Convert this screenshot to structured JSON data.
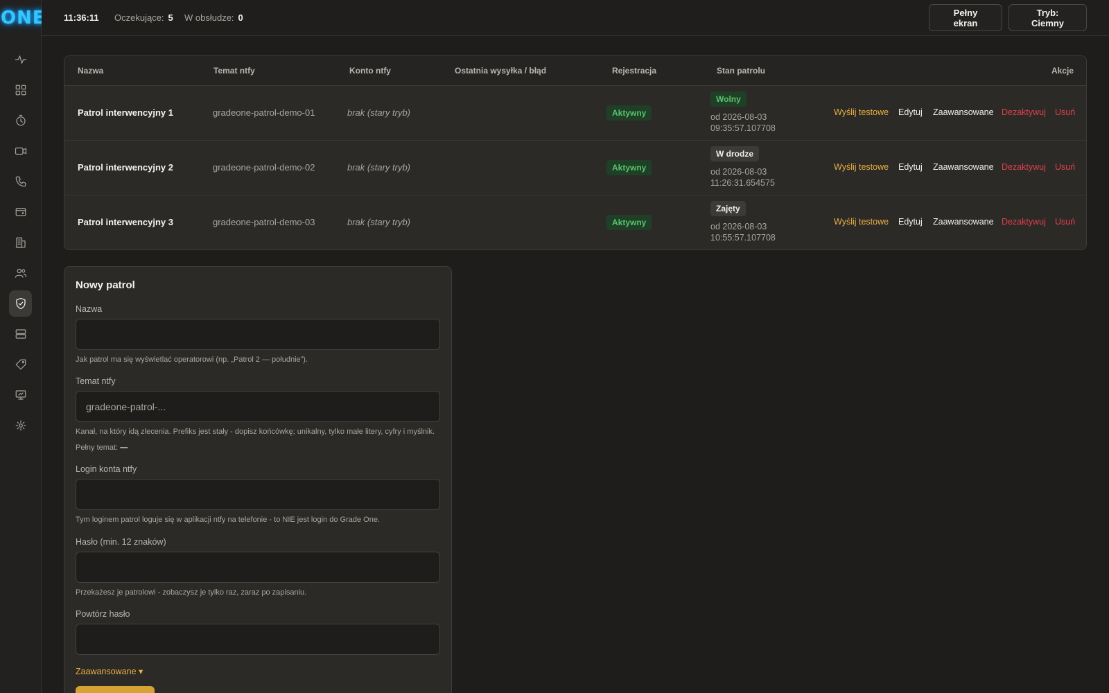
{
  "app": {
    "logo": "ONE"
  },
  "topbar": {
    "clock": "11:36:11",
    "pending_label": "Oczekujące:",
    "pending_value": "5",
    "in_service_label": "W obsłudze:",
    "in_service_value": "0",
    "fullscreen_label": "Pełny ekran",
    "mode_label": "Tryb: Ciemny"
  },
  "sidebar": {
    "items": [
      {
        "icon": "activity-icon"
      },
      {
        "icon": "dashboard-grid-icon"
      },
      {
        "icon": "timer-icon"
      },
      {
        "icon": "video-camera-icon"
      },
      {
        "icon": "phone-icon"
      },
      {
        "icon": "wallet-icon"
      },
      {
        "icon": "building-icon"
      },
      {
        "icon": "users-icon"
      },
      {
        "icon": "shield-check-icon",
        "active": true
      },
      {
        "icon": "server-icon"
      },
      {
        "icon": "tag-icon"
      },
      {
        "icon": "monitor-icon"
      },
      {
        "icon": "settings-icon"
      }
    ]
  },
  "table": {
    "headers": {
      "name": "Nazwa",
      "topic": "Temat ntfy",
      "account": "Konto ntfy",
      "last": "Ostatnia wysyłka / błąd",
      "registration": "Rejestracja",
      "state": "Stan patrolu",
      "actions": "Akcje"
    },
    "rows": [
      {
        "name": "Patrol interwencyjny 1",
        "topic": "gradeone-patrol-demo-01",
        "account": "brak (stary tryb)",
        "registration": "Aktywny",
        "state": "Wolny",
        "state_since_1": "od 2026-08-03",
        "state_since_2": "09:35:57.107708"
      },
      {
        "name": "Patrol interwencyjny 2",
        "topic": "gradeone-patrol-demo-02",
        "account": "brak (stary tryb)",
        "registration": "Aktywny",
        "state": "W drodze",
        "state_since_1": "od 2026-08-03",
        "state_since_2": "11:26:31.654575"
      },
      {
        "name": "Patrol interwencyjny 3",
        "topic": "gradeone-patrol-demo-03",
        "account": "brak (stary tryb)",
        "registration": "Aktywny",
        "state": "Zajęty",
        "state_since_1": "od 2026-08-03",
        "state_since_2": "10:55:57.107708"
      }
    ],
    "actions": {
      "test": "Wyślij testowe",
      "edit": "Edytuj",
      "advanced": "Zaawansowane",
      "deactivate": "Dezaktywuj",
      "delete": "Usuń"
    }
  },
  "form": {
    "title": "Nowy patrol",
    "name_label": "Nazwa",
    "name_value": "",
    "name_hint": "Jak patrol ma się wyświetlać operatorowi (np. „Patrol 2 — południe”).",
    "topic_label": "Temat ntfy",
    "topic_placeholder": "gradeone-patrol-...",
    "topic_hint": "Kanał, na który idą zlecenia. Prefiks jest stały - dopisz końcówkę; unikalny, tylko małe litery, cyfry i myślnik.",
    "full_topic_label": "Pełny temat:",
    "full_topic_value": "—",
    "login_label": "Login konta ntfy",
    "login_value": "",
    "login_hint": "Tym loginem patrol loguje się w aplikacji ntfy na telefonie - to NIE jest login do Grade One.",
    "password_label": "Hasło (min. 12 znaków)",
    "password_value": "",
    "password_hint": "Przekażesz je patrolowi - zobaczysz je tylko raz, zaraz po zapisaniu.",
    "repeat_label": "Powtórz hasło",
    "repeat_value": "",
    "advanced_label": "Zaawansowane ▾"
  },
  "colors": {
    "accent": "#d6a234",
    "active_green": "#59c26e",
    "danger": "#e0404a",
    "logo": "#36c6ff"
  }
}
